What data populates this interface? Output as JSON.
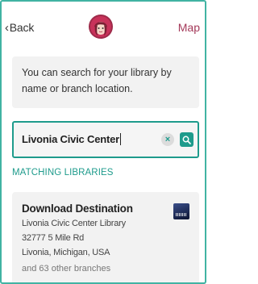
{
  "header": {
    "back_label": "Back",
    "map_label": "Map"
  },
  "info": {
    "text": "You can search for your library by name or branch location."
  },
  "search": {
    "value": "Livonia Civic Center",
    "clear_glyph": "×"
  },
  "results": {
    "section_label": "MATCHING LIBRARIES",
    "items": [
      {
        "name": "Download Destination",
        "branch": "Livonia Civic Center Library",
        "street": "32777 5 Mile Rd",
        "city": "Livonia, Michigan, USA",
        "other_branches": "and 63 other branches"
      }
    ]
  },
  "colors": {
    "accent": "#1e9b8c",
    "frame_border": "#41b3a3",
    "map_link": "#a43a5a",
    "panel_bg": "#f2f2f2"
  },
  "icons": {
    "back": "chevron-left-icon",
    "logo": "libby-logo-icon",
    "clear": "close-icon",
    "search": "search-icon",
    "thumb": "library-thumbnail-icon"
  }
}
